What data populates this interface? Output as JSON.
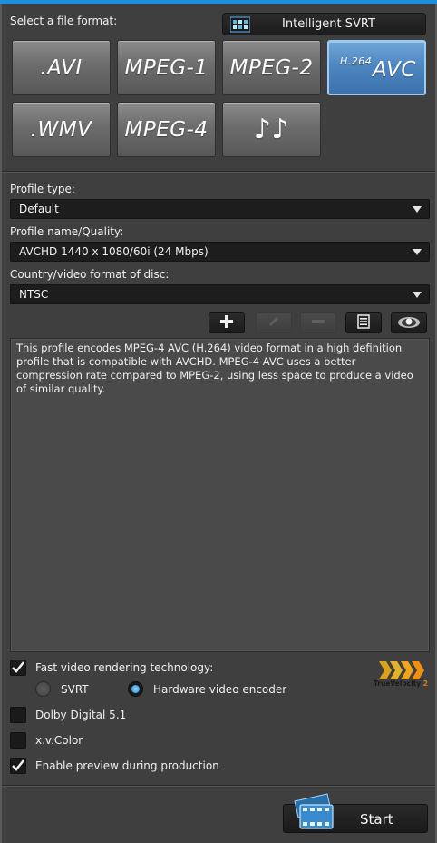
{
  "format": {
    "label": "Select a file format:",
    "svrt_button": "Intelligent SVRT",
    "buttons": [
      ".AVI",
      "MPEG-1",
      "MPEG-2",
      "AVC",
      ".WMV",
      "MPEG-4",
      "♪♪"
    ],
    "avc_superscript": "H.264",
    "selected": "AVC"
  },
  "profile_type": {
    "label": "Profile type:",
    "value": "Default"
  },
  "profile_name": {
    "label": "Profile name/Quality:",
    "value": "AVCHD 1440 x 1080/60i (24 Mbps)"
  },
  "disc_format": {
    "label": "Country/video format of disc:",
    "value": "NTSC"
  },
  "toolbar_icons": [
    "plus-icon",
    "pencil-icon",
    "minus-icon",
    "list-icon",
    "eye-icon"
  ],
  "description": "This profile encodes MPEG-4 AVC (H.264) video format in a high definition profile that is compatible with AVCHD. MPEG-4 AVC uses a better compression rate compared to MPEG-2, using less space to produce a video of similar quality.",
  "options": {
    "fast_rendering": {
      "label": "Fast video rendering technology:",
      "checked": true
    },
    "svrt": {
      "label": "SVRT",
      "selected": false
    },
    "hardware": {
      "label": "Hardware video encoder",
      "selected": true
    },
    "dolby": {
      "label": "Dolby Digital 5.1",
      "checked": false
    },
    "xvcolor": {
      "label": "x.v.Color",
      "checked": false
    },
    "preview": {
      "label": "Enable preview during production",
      "checked": true
    }
  },
  "truevelocity": {
    "brand": "TrueVelocity",
    "version": "2"
  },
  "start_button": "Start",
  "colors": {
    "accent": "#1e8fe0",
    "selected_button": "#4b84bf",
    "panel_bg": "#3f3f3f"
  }
}
